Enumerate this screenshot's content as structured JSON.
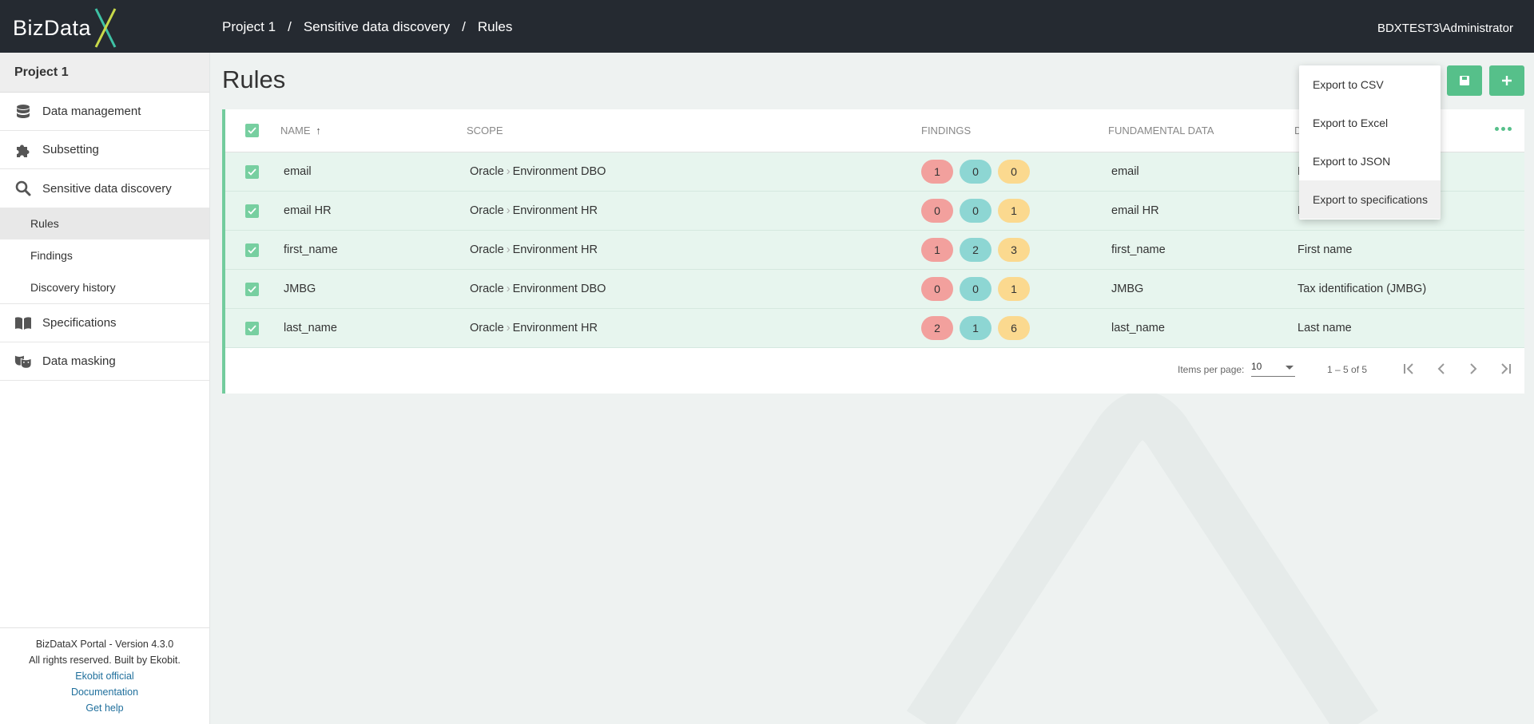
{
  "app": {
    "logo_text": "BizData",
    "user": "BDXTEST3\\Administrator"
  },
  "breadcrumb": [
    "Project 1",
    "Sensitive data discovery",
    "Rules"
  ],
  "sidebar": {
    "project": "Project 1",
    "items": [
      {
        "label": "Data management",
        "icon": "database-icon"
      },
      {
        "label": "Subsetting",
        "icon": "puzzle-icon"
      },
      {
        "label": "Sensitive data discovery",
        "icon": "search-icon"
      },
      {
        "label": "Specifications",
        "icon": "book-icon"
      },
      {
        "label": "Data masking",
        "icon": "masks-icon"
      }
    ],
    "sub_items": [
      "Rules",
      "Findings",
      "Discovery history"
    ],
    "active_sub": "Rules"
  },
  "footer": {
    "version": "BizDataX Portal - Version 4.3.0",
    "rights": "All rights reserved. Built by Ekobit.",
    "links": [
      "Ekobit official",
      "Documentation",
      "Get help"
    ]
  },
  "page": {
    "title": "Rules"
  },
  "table": {
    "headers": {
      "name": "NAME",
      "scope": "SCOPE",
      "findings": "FINDINGS",
      "fundamental": "FUNDAMENTAL DATA",
      "d": "D"
    },
    "rows": [
      {
        "name": "email",
        "scope_db": "Oracle",
        "scope_env": "Environment DBO",
        "findings": [
          1,
          0,
          0
        ],
        "fundamental": "email",
        "d": "E"
      },
      {
        "name": "email HR",
        "scope_db": "Oracle",
        "scope_env": "Environment HR",
        "findings": [
          0,
          0,
          1
        ],
        "fundamental": "email HR",
        "d": "E"
      },
      {
        "name": "first_name",
        "scope_db": "Oracle",
        "scope_env": "Environment HR",
        "findings": [
          1,
          2,
          3
        ],
        "fundamental": "first_name",
        "d": "First name"
      },
      {
        "name": "JMBG",
        "scope_db": "Oracle",
        "scope_env": "Environment DBO",
        "findings": [
          0,
          0,
          1
        ],
        "fundamental": "JMBG",
        "d": "Tax identification (JMBG)"
      },
      {
        "name": "last_name",
        "scope_db": "Oracle",
        "scope_env": "Environment HR",
        "findings": [
          2,
          1,
          6
        ],
        "fundamental": "last_name",
        "d": "Last name"
      }
    ]
  },
  "pager": {
    "items_per_page_label": "Items per page:",
    "items_per_page": "10",
    "range": "1 – 5 of 5"
  },
  "export_menu": [
    "Export to CSV",
    "Export to Excel",
    "Export to JSON",
    "Export to specifications"
  ],
  "colors": {
    "accent": "#56c08a",
    "topbar": "#252a31",
    "finding_red": "#f2a09d",
    "finding_teal": "#8dd6d3",
    "finding_yellow": "#fbd98f"
  }
}
